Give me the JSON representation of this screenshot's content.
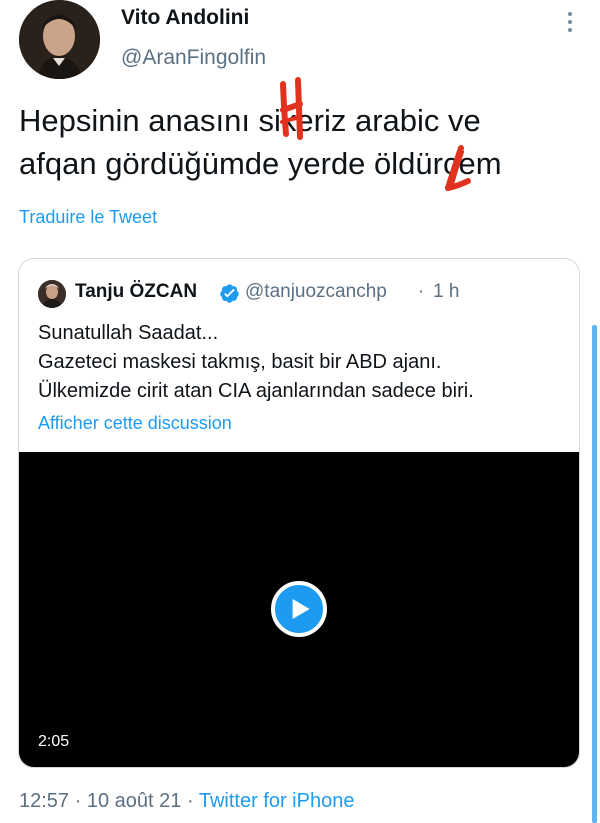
{
  "author": {
    "display_name": "Vito Andolini",
    "handle": "@AranFingolfin"
  },
  "tweet": {
    "lines": [
      "Hepsinin anasını sikeriz arabic ve",
      "afqan gördüğümde yerde öldürcem"
    ],
    "translate_label": "Traduire le Tweet"
  },
  "quoted": {
    "display_name": "Tanju ÖZCAN",
    "handle": "@tanjuozcanchp",
    "separator": "·",
    "time": "1 h",
    "lines": [
      "Sunatullah Saadat...",
      "Gazeteci maskesi takmış, basit bir ABD ajanı.",
      "Ülkemizde cirit atan CIA ajanlarından sadece biri."
    ],
    "show_thread_label": "Afficher cette discussion",
    "video": {
      "duration": "2:05"
    }
  },
  "footer": {
    "time": "12:57",
    "sep1": "·",
    "date": "10 août 21",
    "sep2": "·",
    "source": "Twitter for iPhone"
  },
  "colors": {
    "link": "#1d9bf0",
    "secondary_text": "#5b7083",
    "annotation_red": "#e0321e"
  },
  "icons": {
    "more": "more-vertical-icon",
    "verified": "verified-badge-icon",
    "play": "play-icon"
  }
}
